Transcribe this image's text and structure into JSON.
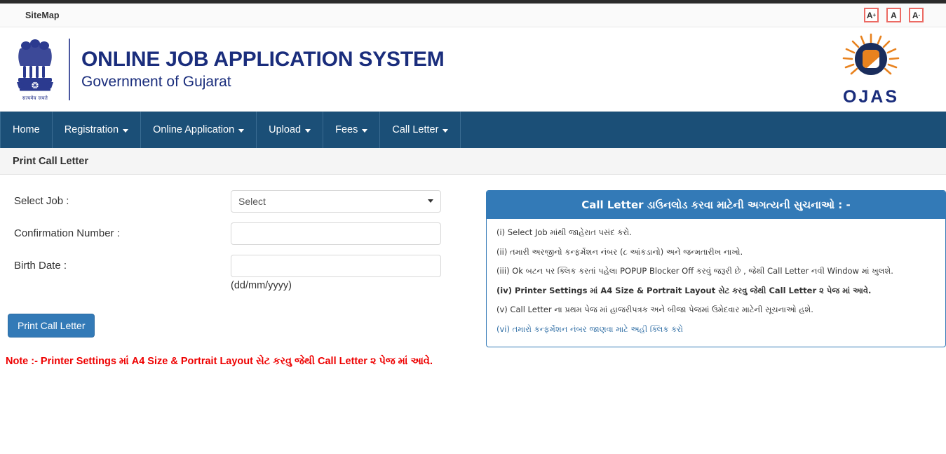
{
  "topbar": {
    "sitemap_label": "SiteMap",
    "font_controls": [
      {
        "name": "increase-font",
        "label": "A",
        "mod": "+"
      },
      {
        "name": "reset-font",
        "label": "A",
        "mod": ""
      },
      {
        "name": "decrease-font",
        "label": "A",
        "mod": "-"
      }
    ],
    "control_border_color": "#ec6a63"
  },
  "masthead": {
    "title": "ONLINE JOB APPLICATION SYSTEM",
    "subtitle": "Government of Gujarat",
    "emblem_icon": "india-state-emblem-icon",
    "emblem_motto": "सत्यमेव जयते",
    "logo_icon": "ojas-sun-logo-icon",
    "logo_word": "OJAS",
    "brand_color": "#1a2d7c"
  },
  "nav": {
    "bg_color": "#1b4f77",
    "items": [
      {
        "label": "Home",
        "has_caret": false
      },
      {
        "label": "Registration",
        "has_caret": true
      },
      {
        "label": "Online Application",
        "has_caret": true
      },
      {
        "label": "Upload",
        "has_caret": true
      },
      {
        "label": "Fees",
        "has_caret": true
      },
      {
        "label": "Call Letter",
        "has_caret": true
      }
    ]
  },
  "page": {
    "heading": "Print Call Letter"
  },
  "form": {
    "select_job": {
      "label": "Select Job :",
      "value": "Select",
      "options": [
        "Select"
      ]
    },
    "confirmation_number": {
      "label": "Confirmation Number :",
      "value": "",
      "placeholder": ""
    },
    "birth_date": {
      "label": "Birth Date :",
      "value": "",
      "placeholder": "",
      "hint": "(dd/mm/yyyy)"
    },
    "submit_label": "Print Call Letter",
    "note": "Note :- Printer Settings માં A4 Size & Portrait Layout સેટ કરવુ જેથી Call Letter ૨ પેજ માં આવે.",
    "note_color": "#ee0000"
  },
  "info_panel": {
    "header": "Call Letter ડાઉનલોડ કરવા માટેની અગત્યની સુચનાઓ : -",
    "accent_color": "#337ab7",
    "items": [
      {
        "text": "(i) Select Job માંથી જાહેરાત પસંદ કરો.",
        "style": "normal"
      },
      {
        "text": "(ii) તમારી અરજીનો કન્ફર્મેશન નંબર (૮ આંકડાનો) અને જન્મતારીખ નાખો.",
        "style": "normal"
      },
      {
        "text": "(iii) Ok બટન પર ક્લિક કરતાં પહેલા POPUP Blocker Off કરવું જરૂરી છે , જેથી Call Letter નવી Window માં ખુલશે.",
        "style": "normal"
      },
      {
        "text": "(iv) Printer Settings માં A4 Size & Portrait Layout સેટ કરવુ જેથી Call Letter ૨ પેજ માં આવે.",
        "style": "bold"
      },
      {
        "text": "(v) Call Letter ના પ્રથમ પેજ માં હાજરીપત્રક અને બીજા પેજમાં ઉમેદવાર માટેની સૂચનાઓ હશે.",
        "style": "normal"
      },
      {
        "text": "(vi) તમારો કન્ફર્મેશન નંબર જાણવા માટે અહી ક્લિક કરો",
        "style": "link"
      }
    ]
  }
}
